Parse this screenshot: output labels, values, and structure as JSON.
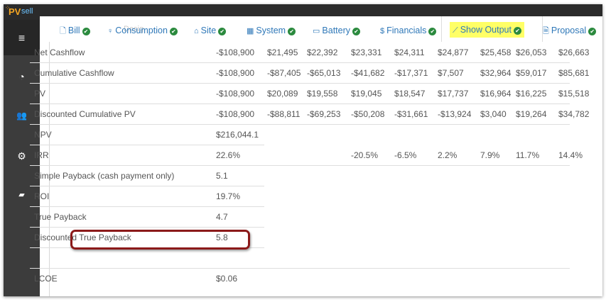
{
  "app": {
    "logo_pv": "PV",
    "logo_sell": "sell",
    "ghost_text": "Desig"
  },
  "sidebar": {
    "items": [
      {
        "icon": "menu-icon",
        "glyph": "≡"
      },
      {
        "icon": "dashboard-icon",
        "glyph": "◔"
      },
      {
        "icon": "users-icon",
        "glyph": "👥"
      },
      {
        "icon": "gear-icon",
        "glyph": "⚙"
      },
      {
        "icon": "book-icon",
        "glyph": "▰"
      }
    ]
  },
  "tabs": [
    {
      "label": "Bill",
      "icon": "file-icon",
      "glyph": "🗋",
      "complete": true
    },
    {
      "label": "Consumption",
      "icon": "bulb-icon",
      "glyph": "💡",
      "complete": true
    },
    {
      "label": "Site",
      "icon": "home-icon",
      "glyph": "⌂",
      "complete": true
    },
    {
      "label": "System",
      "icon": "grid-icon",
      "glyph": "▦",
      "complete": true
    },
    {
      "label": "Battery",
      "icon": "battery-icon",
      "glyph": "▭",
      "complete": true
    },
    {
      "label": "Financials",
      "icon": "dollar-icon",
      "glyph": "$",
      "complete": true
    },
    {
      "label": "Show Output",
      "icon": "chart-line-icon",
      "glyph": "📈",
      "complete": true,
      "highlighted": true
    },
    {
      "label": "Proposal",
      "icon": "pdf-icon",
      "glyph": "🗎",
      "complete": true
    }
  ],
  "table": {
    "rows": [
      {
        "label": "Net Cashflow",
        "values": [
          "-$108,900",
          "$21,495",
          "$22,392",
          "$23,331",
          "$24,311",
          "$24,877",
          "$25,458",
          "$26,053",
          "$26,663"
        ]
      },
      {
        "label": "Cumulative Cashflow",
        "values": [
          "-$108,900",
          "-$87,405",
          "-$65,013",
          "-$41,682",
          "-$17,371",
          "$7,507",
          "$32,964",
          "$59,017",
          "$85,681"
        ]
      },
      {
        "label": "PV",
        "values": [
          "-$108,900",
          "$20,089",
          "$19,558",
          "$19,045",
          "$18,547",
          "$17,737",
          "$16,964",
          "$16,225",
          "$15,518"
        ]
      },
      {
        "label": "Discounted Cumulative PV",
        "values": [
          "-$108,900",
          "-$88,811",
          "-$69,253",
          "-$50,208",
          "-$31,661",
          "-$13,924",
          "$3,040",
          "$19,264",
          "$34,782"
        ]
      },
      {
        "label": "NPV",
        "values": [
          "$216,044.1"
        ]
      },
      {
        "label": "IRR",
        "values": [
          "22.6%",
          "",
          "",
          "-20.5%",
          "-6.5%",
          "2.2%",
          "7.9%",
          "11.7%",
          "14.4%"
        ]
      },
      {
        "label": "Simple Payback (cash payment only)",
        "values": [
          "5.1"
        ]
      },
      {
        "label": "ROI",
        "values": [
          "19.7%"
        ]
      },
      {
        "label": "True Payback",
        "values": [
          "4.7"
        ]
      },
      {
        "label": "Discounted True Payback",
        "values": [
          "5.8"
        ],
        "highlighted": true
      },
      {
        "label": "",
        "values": []
      },
      {
        "label": "LCOE",
        "values": [
          "$0.06"
        ]
      }
    ]
  },
  "colors": {
    "tab_link": "#2f78b8",
    "check": "#2b8a3e",
    "highlight": "#ffff66",
    "callout": "#8b1a1a",
    "sidebar": "#3c3c3c"
  }
}
